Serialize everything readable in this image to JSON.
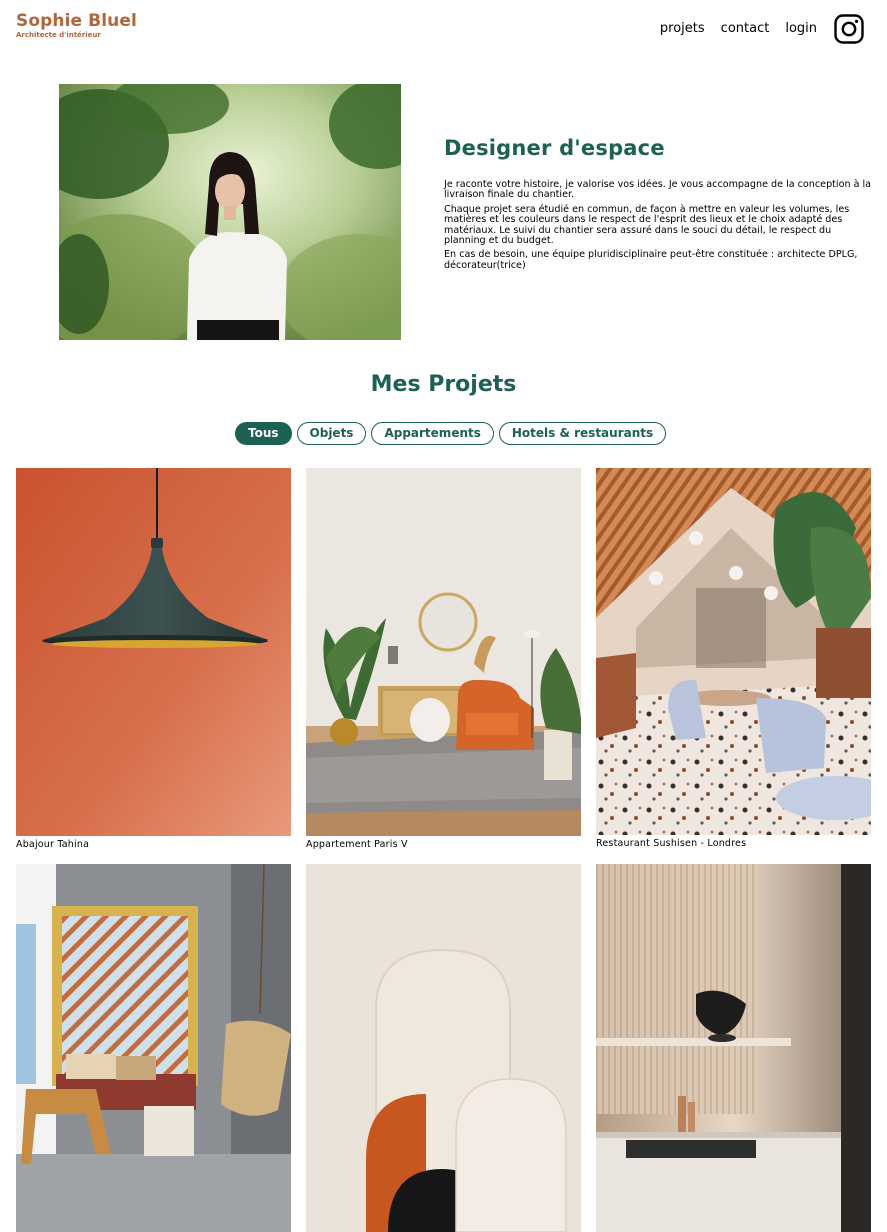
{
  "header": {
    "brand_name": "Sophie Bluel",
    "brand_subtitle": "Architecte d'intérieur",
    "nav": [
      "projets",
      "contact",
      "login"
    ],
    "social_icon": "instagram-icon"
  },
  "intro": {
    "title": "Designer d'espace",
    "paragraphs": [
      "Je raconte votre histoire, je valorise vos idées. Je vous accompagne de la conception à la livraison finale du chantier.",
      "Chaque projet sera étudié en commun, de façon à mettre en valeur les volumes, les matières et les couleurs dans le respect de l'esprit des lieux et le choix adapté des matériaux. Le suivi du chantier sera assuré dans le souci du détail, le respect du planning et du budget.",
      "En cas de besoin, une équipe pluridisciplinaire peut-être constituée : architecte DPLG, décorateur(trice)"
    ]
  },
  "projects": {
    "title": "Mes Projets",
    "filters": [
      "Tous",
      "Objets",
      "Appartements",
      "Hotels & restaurants"
    ],
    "active_filter": "Tous",
    "items": [
      {
        "caption": "Abajour Tahina"
      },
      {
        "caption": "Appartement Paris V"
      },
      {
        "caption": "Restaurant Sushisen - Londres"
      },
      {
        "caption": ""
      },
      {
        "caption": ""
      },
      {
        "caption": ""
      }
    ]
  },
  "colors": {
    "brand": "#B1663C",
    "accent": "#1D6154"
  }
}
